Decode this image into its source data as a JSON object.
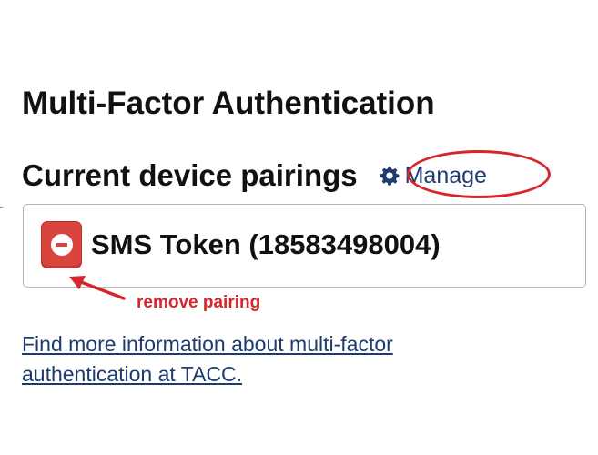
{
  "page": {
    "title": "Multi-Factor Authentication"
  },
  "pairings": {
    "heading": "Current device pairings",
    "manage_label": "Manage",
    "manage_icon": "gear-icon",
    "devices": [
      {
        "label": "SMS Token (18583498004)",
        "remove_icon": "minus-circle-icon"
      }
    ]
  },
  "annotations": {
    "remove_pairing": "remove pairing",
    "highlight_color": "#d7262b"
  },
  "info": {
    "link_text": "Find more information about multi-factor authentication at TACC."
  },
  "colors": {
    "link": "#1d3b6e",
    "remove_button": "#d9443c",
    "annotation": "#d7262b"
  }
}
